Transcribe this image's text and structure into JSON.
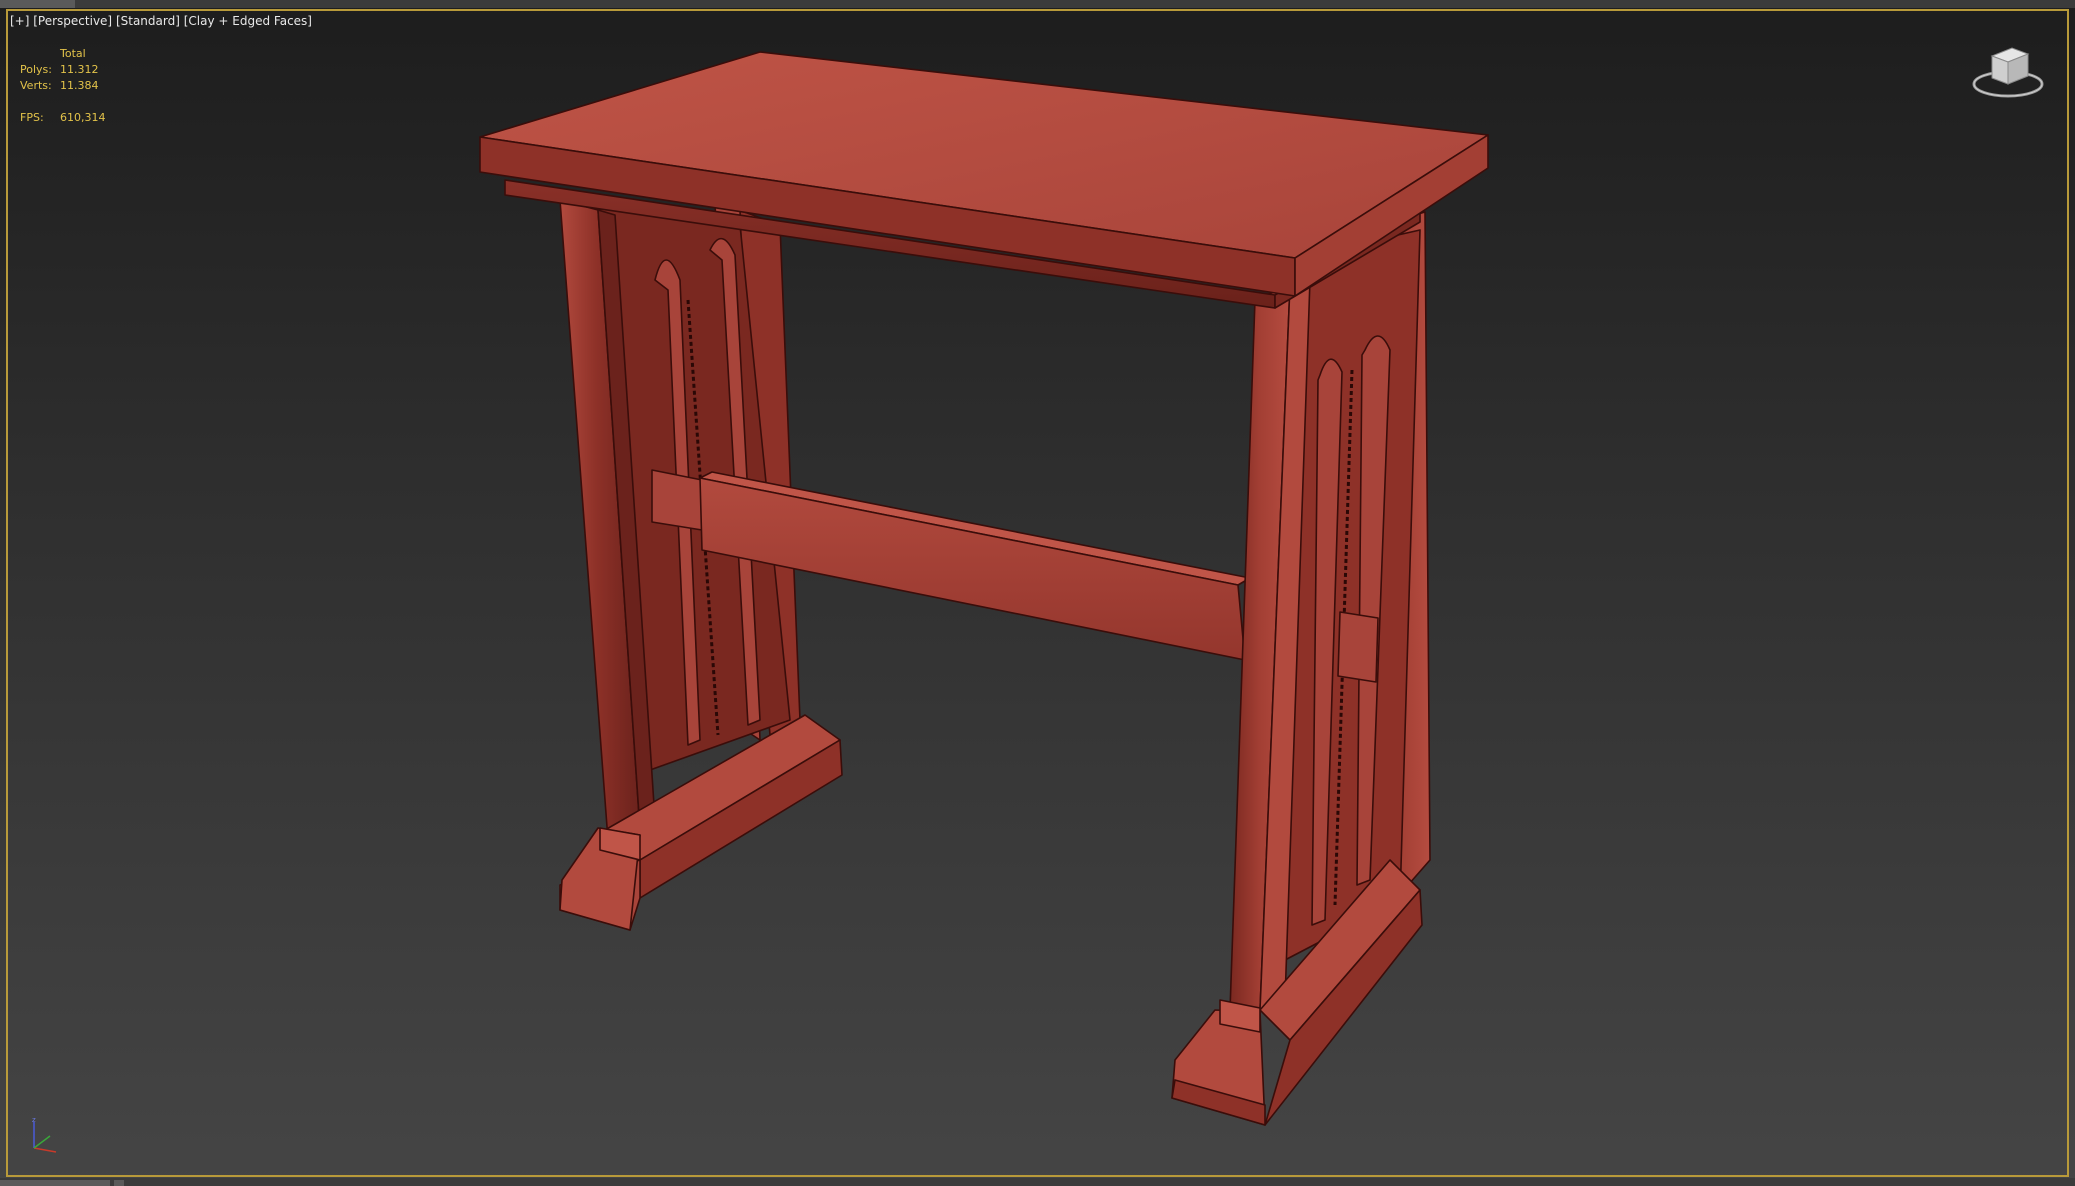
{
  "viewport": {
    "label_parts": [
      "[+]",
      "[Perspective]",
      "[Standard]",
      "[Clay + Edged Faces]"
    ],
    "stats": {
      "header": "Total",
      "polys_label": "Polys:",
      "polys_value": "11.312",
      "verts_label": "Verts:",
      "verts_value": "11.384",
      "fps_label": "FPS:",
      "fps_value": "610,314"
    },
    "viewcube_icon": "viewcube-icon",
    "axis_icon": "axis-tripod-icon"
  },
  "colors": {
    "frame_border": "#b89a3a",
    "stats_text": "#e3c34a",
    "label_text": "#e8e8e8",
    "model_base": "#b24a3e",
    "model_dark": "#6e211b",
    "model_edge": "#3a0d0a"
  },
  "scene": {
    "object": "gothic-side-table-model"
  }
}
